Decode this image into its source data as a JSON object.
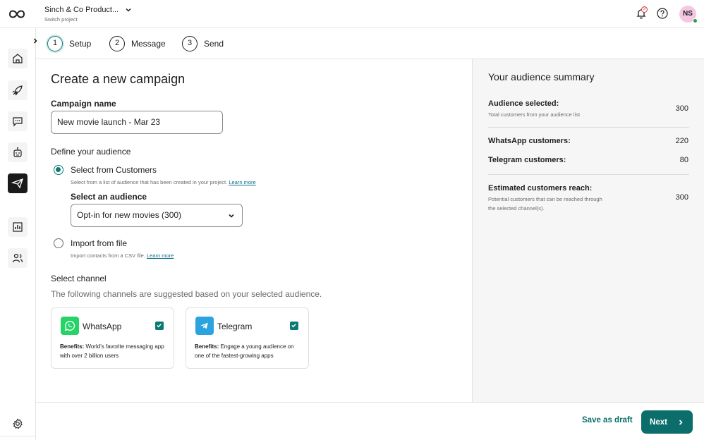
{
  "header": {
    "project_name": "Sinch & Co Product...",
    "project_sub": "Switch project",
    "notification_count": "3",
    "avatar_initials": "NS"
  },
  "stepper": {
    "steps": [
      {
        "num": "1",
        "label": "Setup"
      },
      {
        "num": "2",
        "label": "Message"
      },
      {
        "num": "3",
        "label": "Send"
      }
    ]
  },
  "form": {
    "page_title": "Create a new campaign",
    "campaign_name_label": "Campaign name",
    "campaign_name_value": "New movie launch - Mar 23",
    "audience_label": "Define your audience",
    "option_customers_label": "Select from Customers",
    "option_customers_hint": "Select from a list of audience that has been created in your project.",
    "learn_more": "Learn more",
    "select_audience_label": "Select an audience",
    "select_audience_value": "Opt-in for new movies (300)",
    "option_file_label": "Import from file",
    "option_file_hint": "Import contacts from a CSV file.",
    "channel_label": "Select channel",
    "channel_hint": "The following channels are suggested based on your selected audience.",
    "channels": [
      {
        "name": "WhatsApp",
        "benefit_label": "Benefits:",
        "benefit_text": "World's favorite messaging app with over 2 billion users"
      },
      {
        "name": "Telegram",
        "benefit_label": "Benefits:",
        "benefit_text": "Engage a young audience on one of the fastest-growing apps"
      }
    ]
  },
  "summary": {
    "title": "Your audience summary",
    "audience_selected_label": "Audience selected:",
    "audience_selected_sub": "Total customers from your audience list",
    "audience_selected_value": "300",
    "whatsapp_label": "WhatsApp customers:",
    "whatsapp_value": "220",
    "telegram_label": "Telegram customers:",
    "telegram_value": "80",
    "reach_label": "Estimated customers reach:",
    "reach_sub": "Potential customers that can be reached through the selected channel(s).",
    "reach_value": "300"
  },
  "footer": {
    "draft_label": "Save as draft",
    "next_label": "Next"
  },
  "colors": {
    "accent": "#0b6e6a",
    "whatsapp": "#25d366",
    "telegram": "#2aa3df",
    "avatar_bg": "#f4c7e3"
  }
}
